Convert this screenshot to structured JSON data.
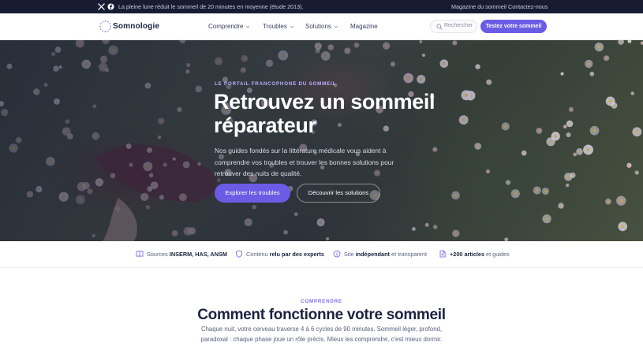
{
  "topbar": {
    "notice": "La pleine lune réduit le sommeil de 20 minutes en moyenne (étude 2013).",
    "links": [
      "Magazine du sommeil",
      "Contactez-nous"
    ],
    "social_icons": [
      "x-icon",
      "facebook-icon"
    ]
  },
  "header": {
    "brand": "Somnologie",
    "nav": [
      {
        "label": "Comprendre",
        "dropdown": true
      },
      {
        "label": "Troubles",
        "dropdown": true
      },
      {
        "label": "Solutions",
        "dropdown": true
      },
      {
        "label": "Magazine",
        "dropdown": false
      }
    ],
    "search_placeholder": "Rechercher",
    "cta": "Testez votre sommeil"
  },
  "hero": {
    "eyebrow": "LE PORTAIL FRANCOPHONE DU SOMMEIL",
    "title": "Retrouvez un sommeil réparateur",
    "lead": "Nos guides fondés sur la littérature médicale vous aident à comprendre vos troubles et trouver les bonnes solutions pour retrouver des nuits de qualité.",
    "primary_button": "Explorer les troubles",
    "secondary_button": "Découvrir les solutions"
  },
  "trust": [
    {
      "icon": "book-icon",
      "prefix": "Sources ",
      "strong": "INSERM, HAS, ANSM",
      "suffix": ""
    },
    {
      "icon": "shield-icon",
      "prefix": "Contenu ",
      "strong": "relu par des experts",
      "suffix": ""
    },
    {
      "icon": "info-icon",
      "prefix": "Site ",
      "strong": "indépendant",
      "suffix": " et transparent"
    },
    {
      "icon": "document-icon",
      "prefix": "",
      "strong": "+200 articles",
      "suffix": " et guides"
    }
  ],
  "section": {
    "eyebrow": "COMPRENDRE",
    "title": "Comment fonctionne votre sommeil",
    "lead": "Chaque nuit, votre cerveau traverse 4 à 6 cycles de 90 minutes. Sommeil léger, profond, paradoxal : chaque phase joue un rôle précis. Mieux les comprendre, c'est mieux dormir."
  },
  "colors": {
    "topbar_bg": "#171c33",
    "accent": "#6b5ce6",
    "text_dark": "#1c2340"
  }
}
